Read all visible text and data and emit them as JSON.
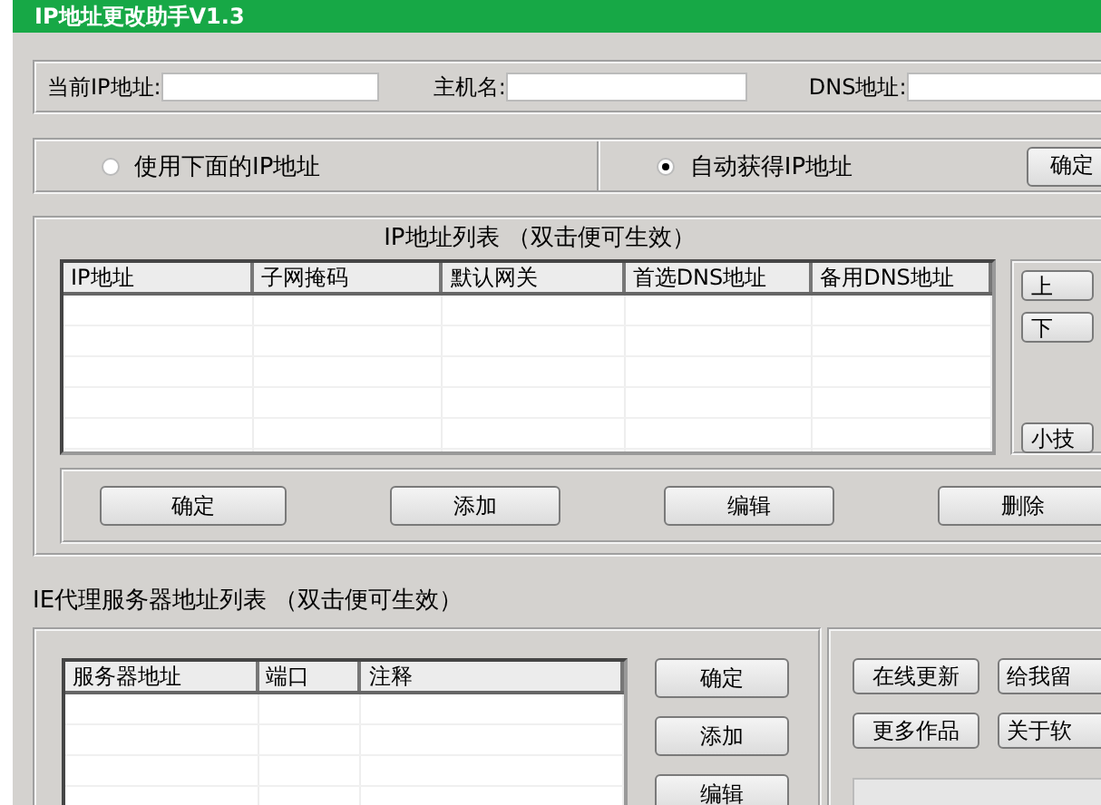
{
  "window": {
    "title": "IP地址更改助手V1.3"
  },
  "current_info": {
    "fields": [
      {
        "label": "当前IP地址:"
      },
      {
        "label": "主机名:"
      },
      {
        "label": "DNS地址:"
      }
    ]
  },
  "mode": {
    "options": [
      {
        "label": "使用下面的IP地址",
        "selected": false
      },
      {
        "label": "自动获得IP地址",
        "selected": true
      }
    ],
    "button": "确定"
  },
  "ip_list": {
    "title": "IP地址列表 （双击便可生效）",
    "columns": [
      "IP地址",
      "子网掩码",
      "默认网关",
      "首选DNS地址",
      "备用DNS地址"
    ],
    "side_buttons": [
      "上",
      "下",
      "小技"
    ],
    "buttons": [
      "确定",
      "添加",
      "编辑",
      "删除"
    ]
  },
  "proxy_list": {
    "title": "IE代理服务器地址列表 （双击便可生效）",
    "columns": [
      "服务器地址",
      "端口",
      "注释"
    ],
    "buttons": [
      "确定",
      "添加",
      "编辑"
    ]
  },
  "extra_buttons": [
    "在线更新",
    "给我留",
    "更多作品",
    "关于软"
  ]
}
